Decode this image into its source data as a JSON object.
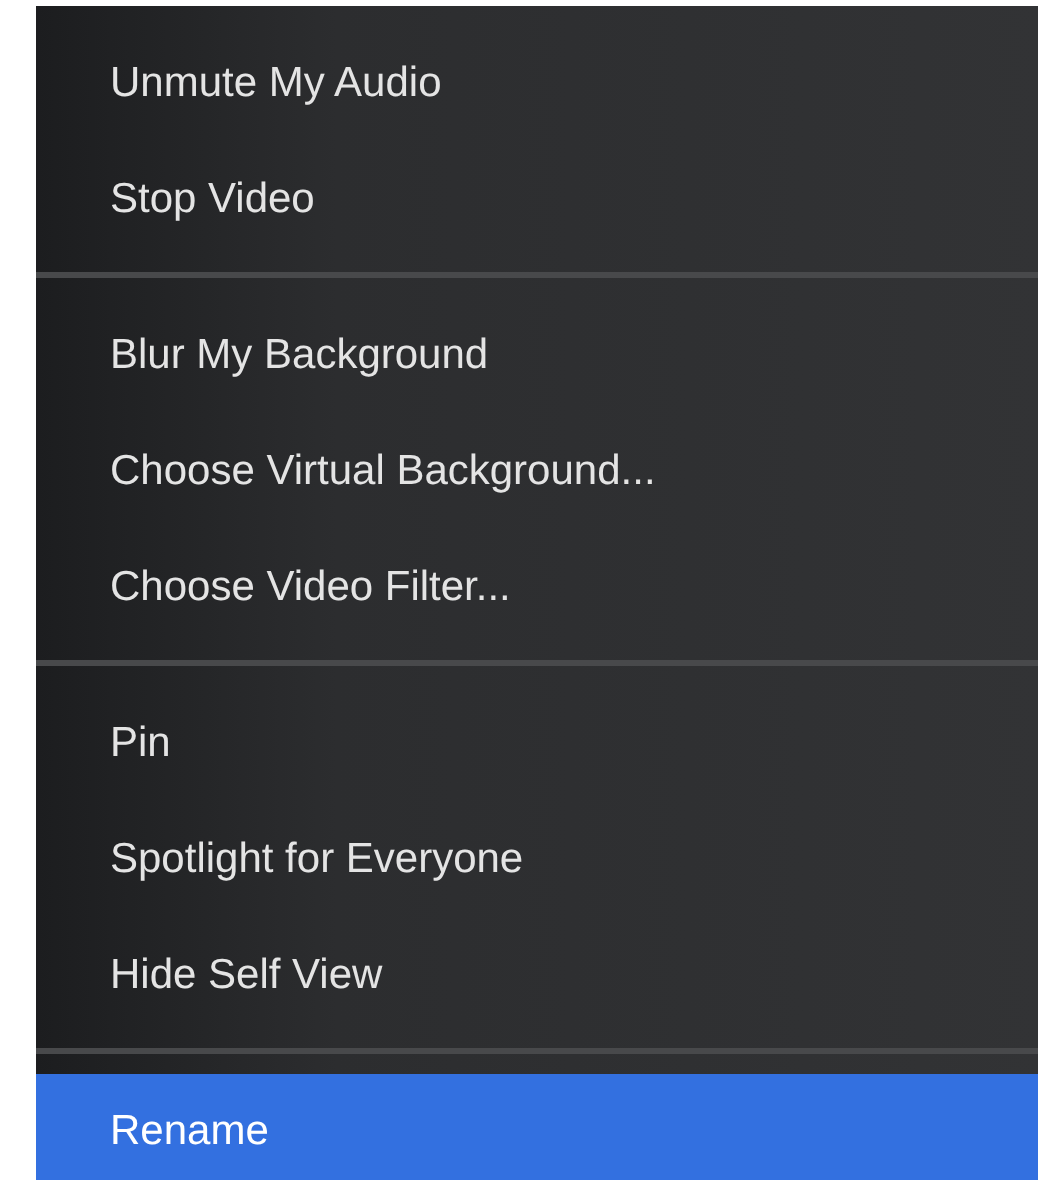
{
  "menu": {
    "items": [
      {
        "kind": "item",
        "label": "Unmute My Audio",
        "selected": false
      },
      {
        "kind": "item",
        "label": "Stop Video",
        "selected": false
      },
      {
        "kind": "separator"
      },
      {
        "kind": "item",
        "label": "Blur My Background",
        "selected": false
      },
      {
        "kind": "item",
        "label": "Choose Virtual Background...",
        "selected": false
      },
      {
        "kind": "item",
        "label": "Choose Video Filter...",
        "selected": false
      },
      {
        "kind": "separator"
      },
      {
        "kind": "item",
        "label": "Pin",
        "selected": false
      },
      {
        "kind": "item",
        "label": "Spotlight for Everyone",
        "selected": false
      },
      {
        "kind": "item",
        "label": "Hide Self View",
        "selected": false
      },
      {
        "kind": "separator"
      },
      {
        "kind": "item",
        "label": "Rename",
        "selected": true
      }
    ]
  }
}
